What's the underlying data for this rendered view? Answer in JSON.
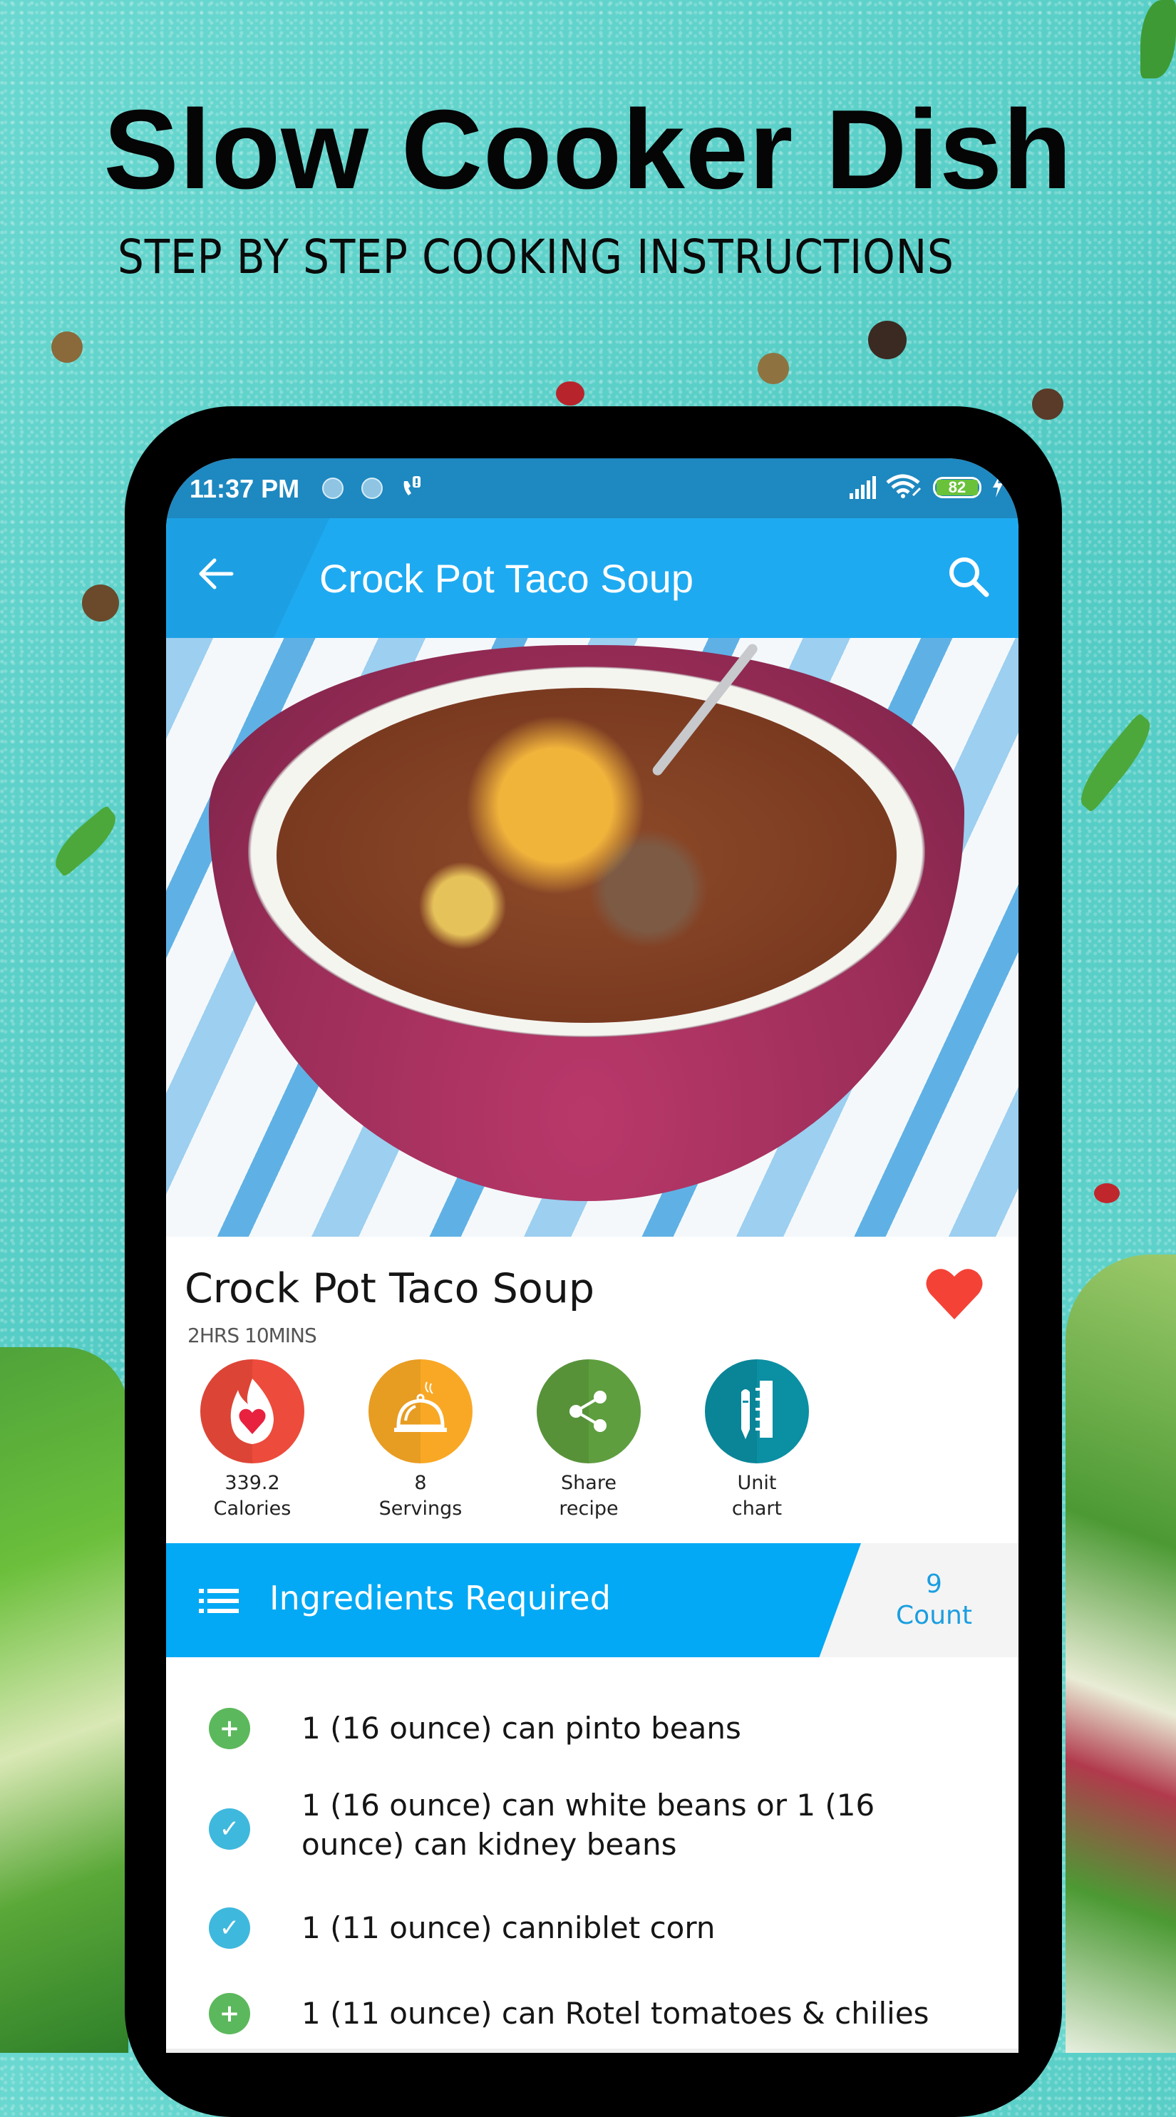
{
  "promo": {
    "title": "Slow Cooker Dish",
    "subtitle": "STEP BY STEP COOKING INSTRUCTIONS"
  },
  "status_bar": {
    "time": "11:37 PM",
    "battery_level": "82",
    "icons": [
      "notification-dot-icon",
      "notification-dot-icon",
      "call-alert-icon",
      "signal-icon",
      "wifi-icon",
      "battery-icon",
      "charging-icon"
    ]
  },
  "app_bar": {
    "title": "Crock Pot Taco Soup",
    "back_icon": "arrow-left-icon",
    "search_icon": "search-icon",
    "color": "#1eaaf1"
  },
  "hero": {
    "image_alt": "Bowl of crock pot taco soup topped with shredded cheddar"
  },
  "recipe": {
    "title": "Crock Pot Taco Soup",
    "time": "2HRS 10MINS",
    "favorite_icon": "heart-icon",
    "favorite_color": "#f44336"
  },
  "actions": [
    {
      "line1": "339.2",
      "line2": "Calories",
      "icon": "calorie-flame-icon",
      "color": "#e94235"
    },
    {
      "line1": "8",
      "line2": "Servings",
      "icon": "serving-cloche-icon",
      "color": "#f9a825"
    },
    {
      "line1": "Share",
      "line2": "recipe",
      "icon": "share-icon",
      "color": "#5e9e3e"
    },
    {
      "line1": "Unit",
      "line2": "chart",
      "icon": "unit-chart-icon",
      "color": "#0b8fa3"
    }
  ],
  "ingredients": {
    "title": "Ingredients Required",
    "count": "9",
    "count_label": "Count",
    "banner_color": "#03a9f4",
    "items": [
      {
        "text": "1 (16 ounce) can pinto beans",
        "status": "add",
        "color": "#5cb85c"
      },
      {
        "text": "1 (16 ounce) can white beans or 1 (16 ounce) can kidney beans",
        "status": "checked",
        "color": "#3fb8dd"
      },
      {
        "text": "1 (11 ounce) canniblet corn",
        "status": "checked",
        "color": "#3fb8dd"
      },
      {
        "text": "1 (11 ounce) can Rotel tomatoes & chilies",
        "status": "add",
        "color": "#5cb85c"
      }
    ]
  }
}
